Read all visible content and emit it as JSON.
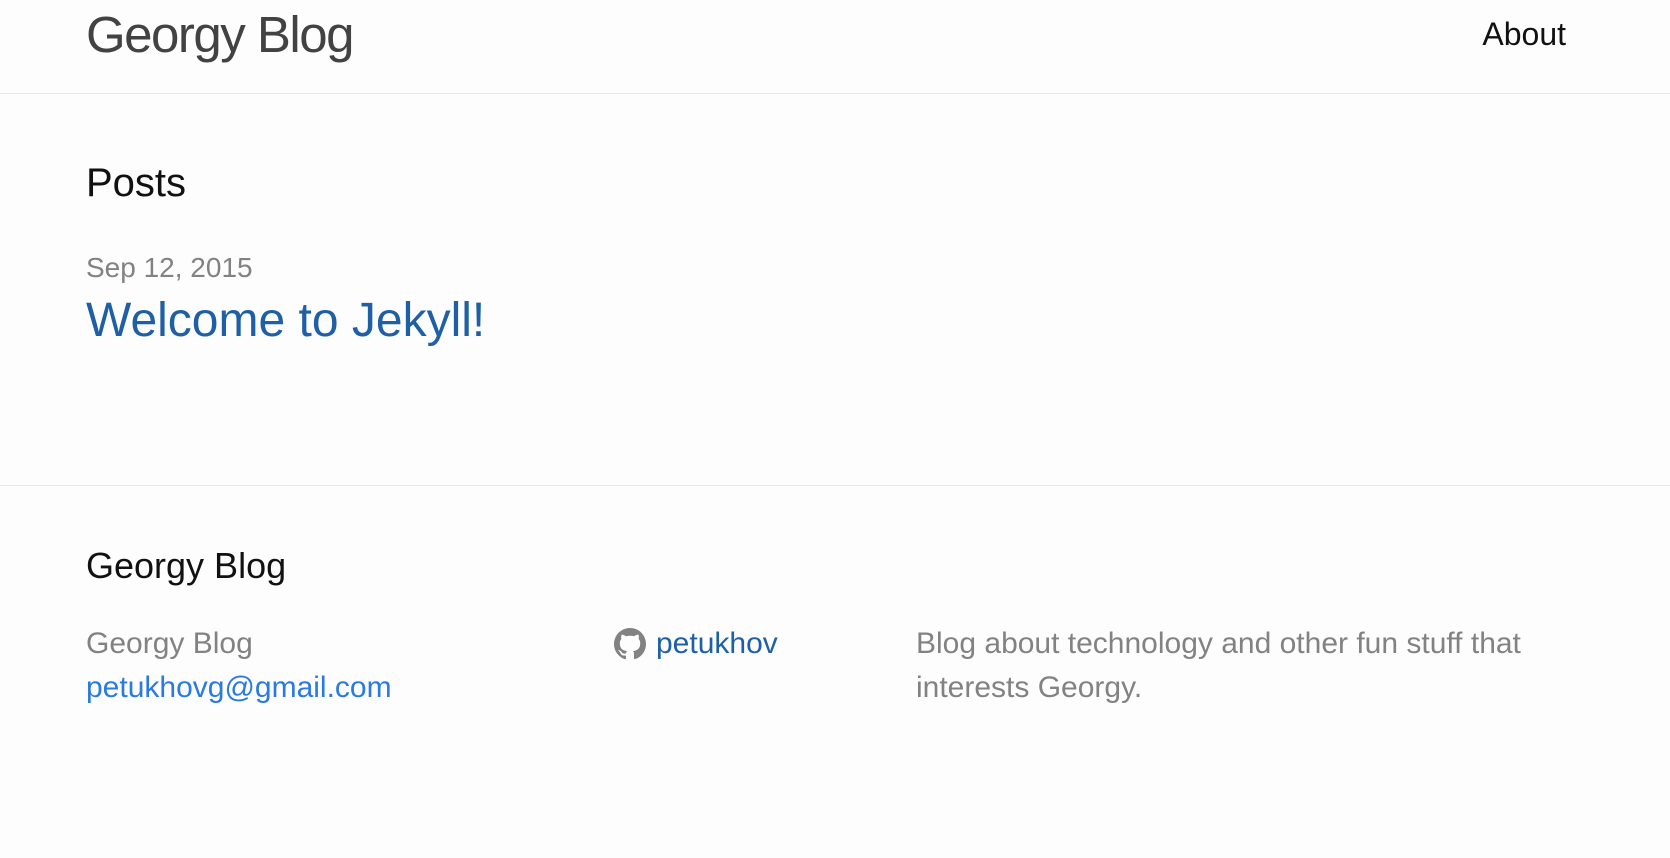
{
  "header": {
    "site_title": "Georgy Blog",
    "nav": [
      {
        "label": "About"
      }
    ]
  },
  "main": {
    "heading": "Posts",
    "posts": [
      {
        "date": "Sep 12, 2015",
        "title": "Welcome to Jekyll!"
      }
    ]
  },
  "footer": {
    "heading": "Georgy Blog",
    "name": "Georgy Blog",
    "email": "petukhovg@gmail.com",
    "github_username": "petukhov",
    "github_icon": "github-icon",
    "description": "Blog about technology and other fun stuff that interests Georgy.",
    "colors": {
      "link": "#2a7ae2",
      "muted": "#828282"
    }
  }
}
